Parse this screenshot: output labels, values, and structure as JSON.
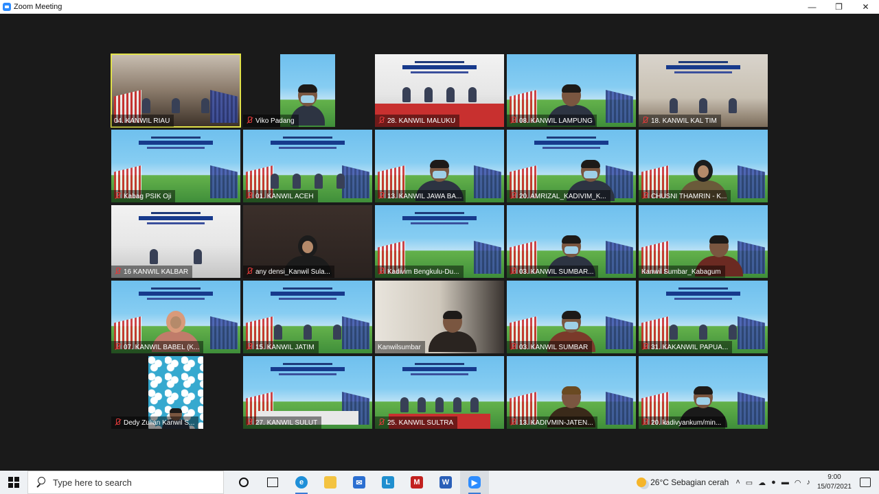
{
  "window": {
    "title": "Zoom Meeting",
    "minimize_glyph": "—",
    "maximize_glyph": "❐",
    "close_glyph": "✕"
  },
  "gallery": {
    "active_speaker_color": "#e2e24a",
    "tiles": [
      {
        "name": "04. KANWIL RIAU",
        "muted": false,
        "active": true
      },
      {
        "name": "Viko Padang",
        "muted": true
      },
      {
        "name": "28. KANWIL MALUKU",
        "muted": true
      },
      {
        "name": "08. KANWIL LAMPUNG",
        "muted": true
      },
      {
        "name": "18. KANWIL KAL TIM",
        "muted": true
      },
      {
        "name": "Kabag PSIK Oji",
        "muted": true
      },
      {
        "name": "01. KANWIL ACEH",
        "muted": true
      },
      {
        "name": "13. KANWIL JAWA BA...",
        "muted": true
      },
      {
        "name": "20. AMRIZAL_KADIVIM_K...",
        "muted": true
      },
      {
        "name": "CHUSNI THAMRIN - K...",
        "muted": true
      },
      {
        "name": "16 KANWIL KALBAR",
        "muted": true
      },
      {
        "name": "any densi_Kanwil Sula...",
        "muted": true
      },
      {
        "name": "Kadivim Bengkulu-Du...",
        "muted": true
      },
      {
        "name": "03. KANWIL SUMBAR...",
        "muted": true
      },
      {
        "name": "Kanwil Sumbar_Kabagum",
        "muted": false
      },
      {
        "name": "07. KANWIL BABEL (K...",
        "muted": true
      },
      {
        "name": "15. KANWIL JATIM",
        "muted": true
      },
      {
        "name": "Kanwilsumbar",
        "muted": false
      },
      {
        "name": "03. KANWIL SUMBAR",
        "muted": true
      },
      {
        "name": "31. KAKANWIL PAPUA...",
        "muted": true
      },
      {
        "name": "Dedy Zulian Kanwil S...",
        "muted": true
      },
      {
        "name": "27. KANWIL SULUT",
        "muted": true
      },
      {
        "name": "25. KANWIL SULTRA",
        "muted": true
      },
      {
        "name": "13. KADIVMIN-JATEN...",
        "muted": true
      },
      {
        "name": "20. kadivyankum/min...",
        "muted": true
      }
    ]
  },
  "taskbar": {
    "search_placeholder": "Type here to search",
    "apps": [
      "cortana-icon",
      "task-view-icon",
      "edge-icon",
      "file-explorer-icon",
      "mail-icon",
      "l-app-icon",
      "mcafee-icon",
      "word-icon",
      "zoom-icon"
    ],
    "weather": "26°C  Sebagian cerah",
    "tray_up": "˄",
    "time": "9:00",
    "date": "15/07/2021"
  }
}
